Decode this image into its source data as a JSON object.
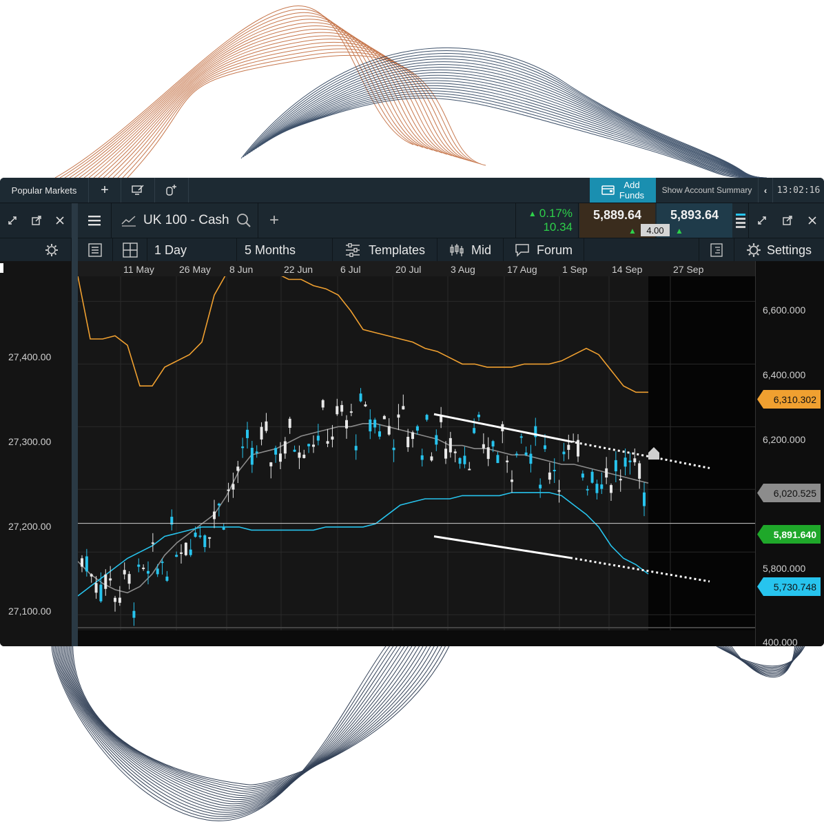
{
  "toolbar": {
    "popular_markets": "Popular Markets",
    "add_funds_line1": "Add",
    "add_funds_line2": "Funds",
    "show_account_summary": "Show Account Summary",
    "clock": "13:02:16"
  },
  "instrument": {
    "name": "UK 100 - Cash",
    "change_pct": "0.17%",
    "change_pts": "10.34",
    "sell_price": "5,889.64",
    "buy_price": "5,893.64",
    "spread": "4.00"
  },
  "chart_toolbar": {
    "interval": "1 Day",
    "range": "5 Months",
    "templates": "Templates",
    "mid": "Mid",
    "forum": "Forum",
    "settings": "Settings"
  },
  "colors": {
    "upper_band": "#f0a030",
    "lower_band": "#27c4ee",
    "middle_band": "#8c8c8c",
    "current_price": "#1fa82a",
    "add_funds": "#1a8fb0"
  },
  "chart_data": {
    "type": "candlestick",
    "x_ticks": [
      "11 May",
      "26 May",
      "8 Jun",
      "22 Jun",
      "6 Jul",
      "20 Jul",
      "3 Aug",
      "17 Aug",
      "1 Sep",
      "14 Sep",
      "27 Sep"
    ],
    "right_axis_ticks": [
      "6,600.000",
      "6,400.000",
      "6,200.000",
      "5,800.000",
      "400.000"
    ],
    "left_axis_ticks": [
      "27,400.00",
      "27,300.00",
      "27,200.00",
      "27,100.00"
    ],
    "ylim": [
      5550,
      6680
    ],
    "indicators": {
      "upper_band_last": "6,310.302",
      "middle_band_last": "6,020.525",
      "lower_band_last": "5,730.748",
      "current_price": "5,891.640"
    },
    "upper_band": [
      6680,
      6480,
      6480,
      6490,
      6460,
      6330,
      6330,
      6390,
      6410,
      6430,
      6470,
      6620,
      6690,
      6710,
      6710,
      6700,
      6690,
      6670,
      6670,
      6650,
      6640,
      6620,
      6570,
      6510,
      6500,
      6490,
      6480,
      6470,
      6450,
      6440,
      6420,
      6400,
      6400,
      6390,
      6390,
      6390,
      6400,
      6400,
      6400,
      6410,
      6430,
      6450,
      6430,
      6380,
      6330,
      6310,
      6310
    ],
    "middle_band": [
      5770,
      5730,
      5700,
      5680,
      5670,
      5690,
      5730,
      5790,
      5830,
      5860,
      5890,
      5920,
      5980,
      6060,
      6110,
      6120,
      6130,
      6150,
      6170,
      6180,
      6190,
      6200,
      6200,
      6210,
      6210,
      6200,
      6190,
      6180,
      6170,
      6160,
      6140,
      6140,
      6130,
      6130,
      6120,
      6110,
      6110,
      6100,
      6090,
      6080,
      6080,
      6070,
      6060,
      6050,
      6040,
      6030,
      6020
    ],
    "lower_band": [
      5660,
      5690,
      5720,
      5750,
      5780,
      5800,
      5820,
      5850,
      5860,
      5870,
      5880,
      5880,
      5880,
      5880,
      5870,
      5870,
      5870,
      5870,
      5870,
      5870,
      5880,
      5880,
      5880,
      5880,
      5890,
      5920,
      5950,
      5960,
      5970,
      5970,
      5970,
      5980,
      5980,
      5980,
      5980,
      5990,
      5990,
      5990,
      5990,
      5980,
      5950,
      5920,
      5880,
      5820,
      5780,
      5760,
      5730
    ],
    "annotations": {
      "upper_trendline": [
        [
          630,
          6240
        ],
        [
          948,
          6100
        ]
      ],
      "lower_trendline": [
        [
          630,
          5850
        ],
        [
          948,
          5740
        ]
      ]
    }
  }
}
